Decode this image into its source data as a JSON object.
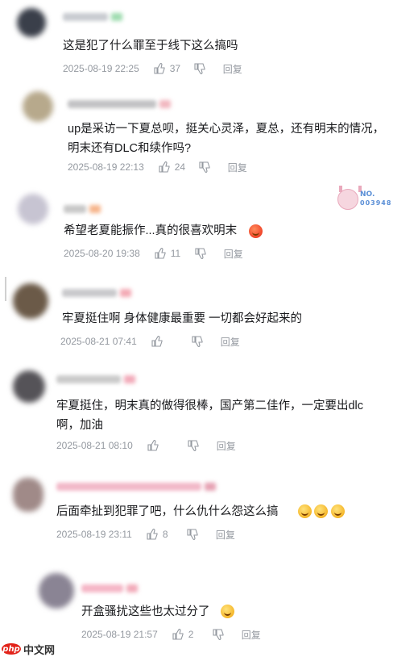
{
  "comments": [
    {
      "content": "这是犯了什么罪至于线下这么搞吗",
      "time": "2025-08-19 22:25",
      "likes": "37",
      "reply_label": "回复",
      "avatar_color": "#3a3f4a",
      "name_color": "#c9ccd1"
    },
    {
      "content": "up是采访一下夏总呗，挺关心灵泽，夏总，还有明末的情况，\n明末还有DLC和续作吗?",
      "time": "2025-08-19 22:13",
      "likes": "24",
      "reply_label": "回复",
      "avatar_color": "#b7a98c",
      "name_color": "#c2c2c4"
    },
    {
      "content": "希望老夏能振作...真的很喜欢明末",
      "time": "2025-08-20 19:38",
      "likes": "11",
      "reply_label": "回复",
      "avatar_color": "#c7c4d2",
      "name_color": "#c8c8c8"
    },
    {
      "content": "牢夏挺住啊 身体健康最重要 一切都会好起来的",
      "time": "2025-08-21 07:41",
      "likes": "",
      "reply_label": "回复",
      "avatar_color": "#6b5a48",
      "name_color": "#c9c9cc"
    },
    {
      "content": "牢夏挺住，明末真的做得很棒，国产第二佳作，一定要出dlc\n啊，加油",
      "time": "2025-08-21 08:10",
      "likes": "",
      "reply_label": "回复",
      "avatar_color": "#555358",
      "name_color": "#cacaca"
    },
    {
      "content": "后面牵扯到犯罪了吧，什么仇什么怨这么搞",
      "time": "2025-08-19 23:11",
      "likes": "8",
      "reply_label": "回复",
      "avatar_color": "#a08a88",
      "name_color": "#f2b8c8"
    },
    {
      "content": "开盒骚扰这些也太过分了",
      "time": "2025-08-19 21:57",
      "likes": "2",
      "reply_label": "回复",
      "avatar_color": "#8a8494",
      "name_color": "#f5b6c6"
    }
  ],
  "sticker": {
    "line1": "NO.",
    "line2": "003948"
  },
  "watermark": {
    "badge": "php",
    "text": "中文网"
  },
  "colors": {
    "meta_text": "#9499a0",
    "content_text": "#18191c"
  }
}
